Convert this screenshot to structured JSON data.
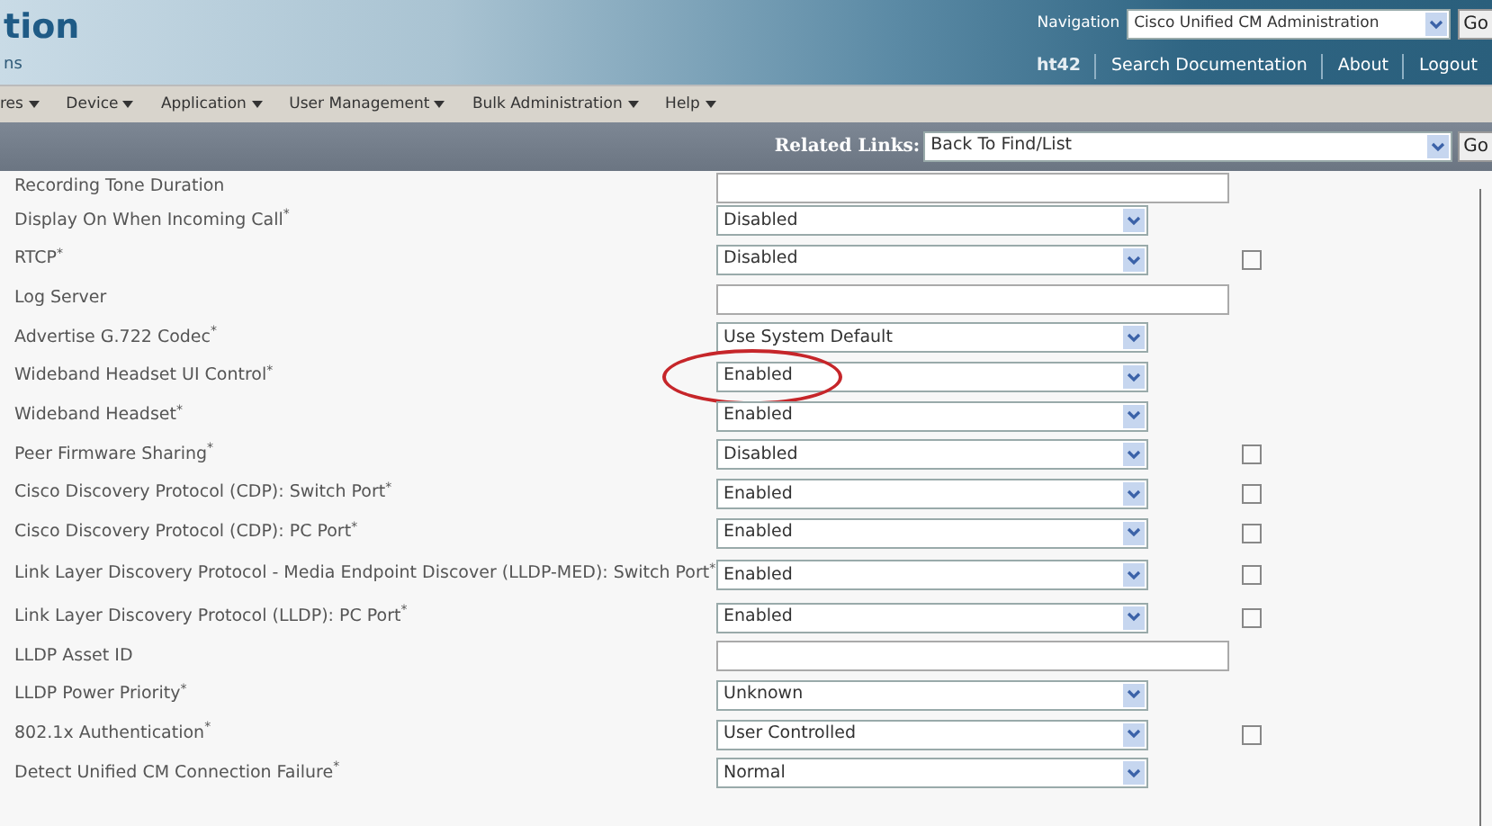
{
  "header": {
    "title": "tion",
    "subtitle": "ns",
    "navigation_label": "Navigation",
    "navigation_select": "Cisco Unified CM Administration",
    "navigation_go": "Go",
    "user": "ht42",
    "links": [
      "Search Documentation",
      "About",
      "Logout"
    ]
  },
  "menu": [
    "res",
    "Device",
    "Application",
    "User Management",
    "Bulk Administration",
    "Help"
  ],
  "related_links": {
    "label": "Related Links:",
    "select": "Back To Find/List",
    "go": "Go"
  },
  "rows": [
    {
      "label": "Recording Tone Duration",
      "kind": "text",
      "value": ""
    },
    {
      "label": "Display On When Incoming Call$^{*}$",
      "kind": "select",
      "value": "Disabled"
    },
    {
      "label": "RTCP$^{*}$",
      "kind": "select",
      "value": "Disabled",
      "checkbox": {
        "checked": false
      }
    },
    {
      "label": "Log Server",
      "kind": "text",
      "value": ""
    },
    {
      "label": "Advertise G.722 Codec$^{*}$",
      "kind": "select",
      "value": "Use System Default"
    },
    {
      "label": "Wideband Headset UI Control$^{*}$",
      "kind": "select",
      "value": "Enabled",
      "circled": true
    },
    {
      "label": "Wideband Headset$^{*}$",
      "kind": "select",
      "value": "Enabled"
    },
    {
      "label": "Peer Firmware Sharing$^{*}$",
      "kind": "select",
      "value": "Disabled",
      "checkbox": {
        "checked": false
      }
    },
    {
      "label": "Cisco Discovery Protocol (CDP): Switch Port$^{*}$",
      "kind": "select",
      "value": "Enabled",
      "checkbox": {
        "checked": false
      }
    },
    {
      "label": "Cisco Discovery Protocol (CDP): PC Port$^{*}$",
      "kind": "select",
      "value": "Enabled",
      "checkbox": {
        "checked": false
      }
    },
    {
      "label": "Link Layer Discovery Protocol - Media Endpoint Discover (LLDP-MED): Switch Port$^{*}$",
      "kind": "select",
      "value": "Enabled",
      "checkbox": {
        "checked": false
      }
    },
    {
      "label": "Link Layer Discovery Protocol (LLDP): PC Port$^{*}$",
      "kind": "select",
      "value": "Enabled",
      "checkbox": {
        "checked": false
      }
    },
    {
      "label": "LLDP Asset ID",
      "kind": "text",
      "value": ""
    },
    {
      "label": "LLDP Power Priority$^{*}$",
      "kind": "select",
      "value": "Unknown"
    },
    {
      "label": "802.1x Authentication$^{*}$",
      "kind": "select",
      "value": "User Controlled",
      "checkbox": {
        "checked": false
      }
    },
    {
      "label": "Detect Unified CM Connection Failure$^{*}$",
      "kind": "select",
      "value": "Normal"
    }
  ]
}
